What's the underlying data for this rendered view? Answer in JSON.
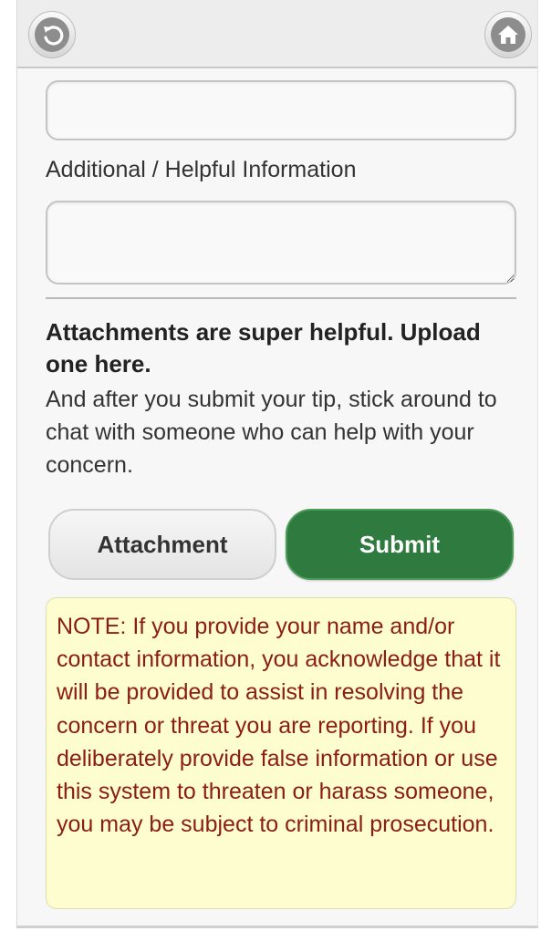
{
  "header": {
    "back_icon": "back-arrow-icon",
    "home_icon": "home-icon"
  },
  "form": {
    "top_field_value": "",
    "additional_info_label": "Additional / Helpful Information",
    "additional_info_value": ""
  },
  "attachments": {
    "heading": "Attachments are super helpful. Upload one here.",
    "body": "And after you submit your tip, stick around to chat with someone who can help with your concern."
  },
  "actions": {
    "attachment_label": "Attachment",
    "submit_label": "Submit"
  },
  "note": {
    "text": "NOTE: If you provide your name and/or contact information, you acknowledge that it will be provided to assist in resolving the concern or threat you are reporting. If you deliberately provide false information or use this system to threaten or harass someone, you may be subject to criminal prosecution."
  },
  "colors": {
    "submit_green": "#2f7a3e",
    "note_background": "#fdfdd0",
    "note_text": "#8b1d14"
  }
}
